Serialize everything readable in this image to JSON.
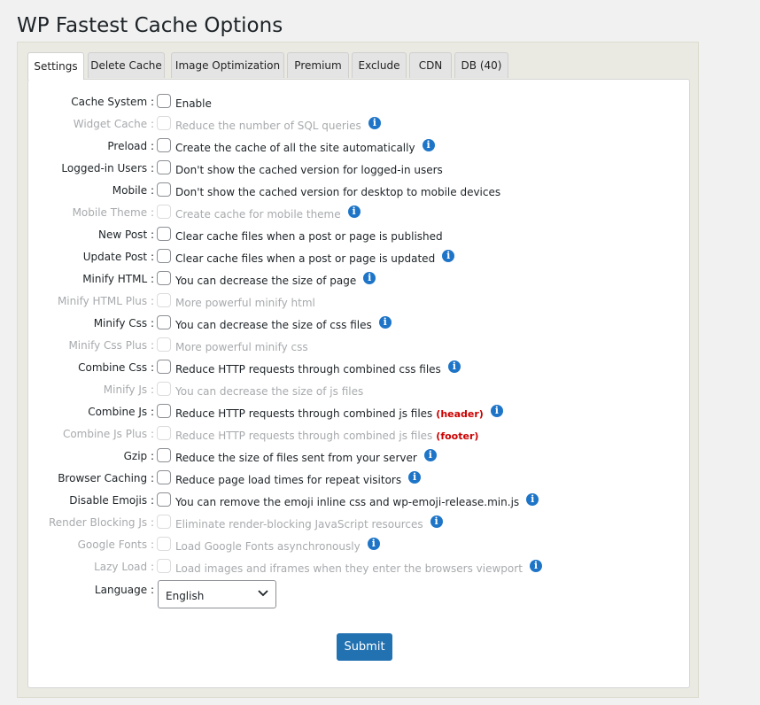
{
  "page": {
    "title": "WP Fastest Cache Options"
  },
  "tabs": [
    {
      "label": "Settings",
      "active": true
    },
    {
      "label": "Delete Cache"
    },
    {
      "label": "Image Optimization"
    },
    {
      "label": "Premium"
    },
    {
      "label": "Exclude"
    },
    {
      "label": "CDN"
    },
    {
      "label": "DB (40)"
    }
  ],
  "options": [
    {
      "label": "Cache System :",
      "desc": "Enable",
      "enabled": true,
      "info": false
    },
    {
      "label": "Widget Cache :",
      "desc": "Reduce the number of SQL queries",
      "enabled": false,
      "info": true
    },
    {
      "label": "Preload :",
      "desc": "Create the cache of all the site automatically",
      "enabled": true,
      "info": true
    },
    {
      "label": "Logged-in Users :",
      "desc": "Don't show the cached version for logged-in users",
      "enabled": true,
      "info": false
    },
    {
      "label": "Mobile :",
      "desc": "Don't show the cached version for desktop to mobile devices",
      "enabled": true,
      "info": false
    },
    {
      "label": "Mobile Theme :",
      "desc": "Create cache for mobile theme",
      "enabled": false,
      "info": true
    },
    {
      "label": "New Post :",
      "desc": "Clear cache files when a post or page is published",
      "enabled": true,
      "info": false
    },
    {
      "label": "Update Post :",
      "desc": "Clear cache files when a post or page is updated",
      "enabled": true,
      "info": true
    },
    {
      "label": "Minify HTML :",
      "desc": "You can decrease the size of page",
      "enabled": true,
      "info": true
    },
    {
      "label": "Minify HTML Plus :",
      "desc": "More powerful minify html",
      "enabled": false,
      "info": false
    },
    {
      "label": "Minify Css :",
      "desc": "You can decrease the size of css files",
      "enabled": true,
      "info": true
    },
    {
      "label": "Minify Css Plus :",
      "desc": "More powerful minify css",
      "enabled": false,
      "info": false
    },
    {
      "label": "Combine Css :",
      "desc": "Reduce HTTP requests through combined css files",
      "enabled": true,
      "info": true
    },
    {
      "label": "Minify Js :",
      "desc": "You can decrease the size of js files",
      "enabled": false,
      "info": false
    },
    {
      "label": "Combine Js :",
      "desc": "Reduce HTTP requests through combined js files",
      "tag": "(header)",
      "enabled": true,
      "info": true
    },
    {
      "label": "Combine Js Plus :",
      "desc": "Reduce HTTP requests through combined js files",
      "tag": "(footer)",
      "enabled": false,
      "info": false
    },
    {
      "label": "Gzip :",
      "desc": "Reduce the size of files sent from your server",
      "enabled": true,
      "info": true
    },
    {
      "label": "Browser Caching :",
      "desc": "Reduce page load times for repeat visitors",
      "enabled": true,
      "info": true
    },
    {
      "label": "Disable Emojis :",
      "desc": "You can remove the emoji inline css and wp-emoji-release.min.js",
      "enabled": true,
      "info": true
    },
    {
      "label": "Render Blocking Js :",
      "desc": "Eliminate render-blocking JavaScript resources",
      "enabled": false,
      "info": true
    },
    {
      "label": "Google Fonts :",
      "desc": "Load Google Fonts asynchronously",
      "enabled": false,
      "info": true
    },
    {
      "label": "Lazy Load :",
      "desc": "Load images and iframes when they enter the browsers viewport",
      "enabled": false,
      "info": true
    }
  ],
  "language": {
    "label": "Language :",
    "value": "English"
  },
  "submit": {
    "label": "Submit"
  },
  "colors": {
    "accent": "#2271b1",
    "info": "#1e75c7",
    "tag": "#cc0000"
  }
}
